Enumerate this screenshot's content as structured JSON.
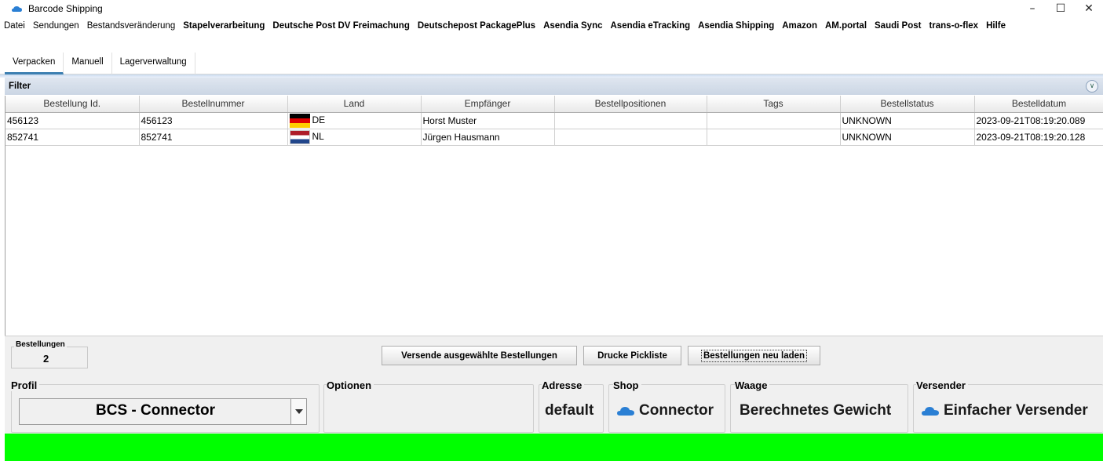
{
  "window": {
    "title": "Barcode Shipping",
    "minimize": "–",
    "maximize": "☐",
    "close": "✕"
  },
  "menu": [
    {
      "label": "Datei",
      "bold": false
    },
    {
      "label": "Sendungen",
      "bold": false
    },
    {
      "label": "Bestandsveränderung",
      "bold": false
    },
    {
      "label": "Stapelverarbeitung",
      "bold": true
    },
    {
      "label": "Deutsche Post DV Freimachung",
      "bold": true
    },
    {
      "label": "Deutschepost PackagePlus",
      "bold": true
    },
    {
      "label": "Asendia Sync",
      "bold": true
    },
    {
      "label": "Asendia eTracking",
      "bold": true
    },
    {
      "label": "Asendia Shipping",
      "bold": true
    },
    {
      "label": "Amazon",
      "bold": true
    },
    {
      "label": "AM.portal",
      "bold": true
    },
    {
      "label": "Saudi Post",
      "bold": true
    },
    {
      "label": "trans-o-flex",
      "bold": true
    },
    {
      "label": "Hilfe",
      "bold": true
    }
  ],
  "tabs": [
    {
      "label": "Verpacken",
      "active": true
    },
    {
      "label": "Manuell",
      "active": false
    },
    {
      "label": "Lagerverwaltung",
      "active": false
    }
  ],
  "filter": {
    "label": "Filter",
    "expand_icon": "chevron-double-down-icon"
  },
  "table": {
    "columns": [
      "Bestellung Id.",
      "Bestellnummer",
      "Land",
      "Empfänger",
      "Bestellpositionen",
      "Tags",
      "Bestellstatus",
      "Bestelldatum"
    ],
    "rows": [
      {
        "id": "456123",
        "number": "456123",
        "country": "DE",
        "flag": "flag-de",
        "recipient": "Horst Muster",
        "positions": "",
        "tags": "",
        "status": "UNKNOWN",
        "date": "2023-09-21T08:19:20.089"
      },
      {
        "id": "852741",
        "number": "852741",
        "country": "NL",
        "flag": "flag-nl",
        "recipient": "Jürgen Hausmann",
        "positions": "",
        "tags": "",
        "status": "UNKNOWN",
        "date": "2023-09-21T08:19:20.128"
      }
    ]
  },
  "orders_count": {
    "label": "Bestellungen",
    "value": "2"
  },
  "buttons": {
    "send": "Versende ausgewählte Bestellungen",
    "pick": "Drucke Pickliste",
    "reload": "Bestellungen neu laden"
  },
  "sections": {
    "profile": {
      "title": "Profil",
      "value": "BCS - Connector"
    },
    "options": {
      "title": "Optionen",
      "value": ""
    },
    "address": {
      "title": "Adresse",
      "value": "default"
    },
    "shop": {
      "title": "Shop",
      "value": "Connector",
      "icon": "cloud-icon"
    },
    "scale": {
      "title": "Waage",
      "value": "Berechnetes Gewicht"
    },
    "shipper": {
      "title": "Versender",
      "value": "Einfacher Versender",
      "icon": "cloud-icon"
    }
  },
  "colors": {
    "status_bar": "#00ff00",
    "accent": "#3c7fb1",
    "cloud": "#2a7fd4"
  }
}
